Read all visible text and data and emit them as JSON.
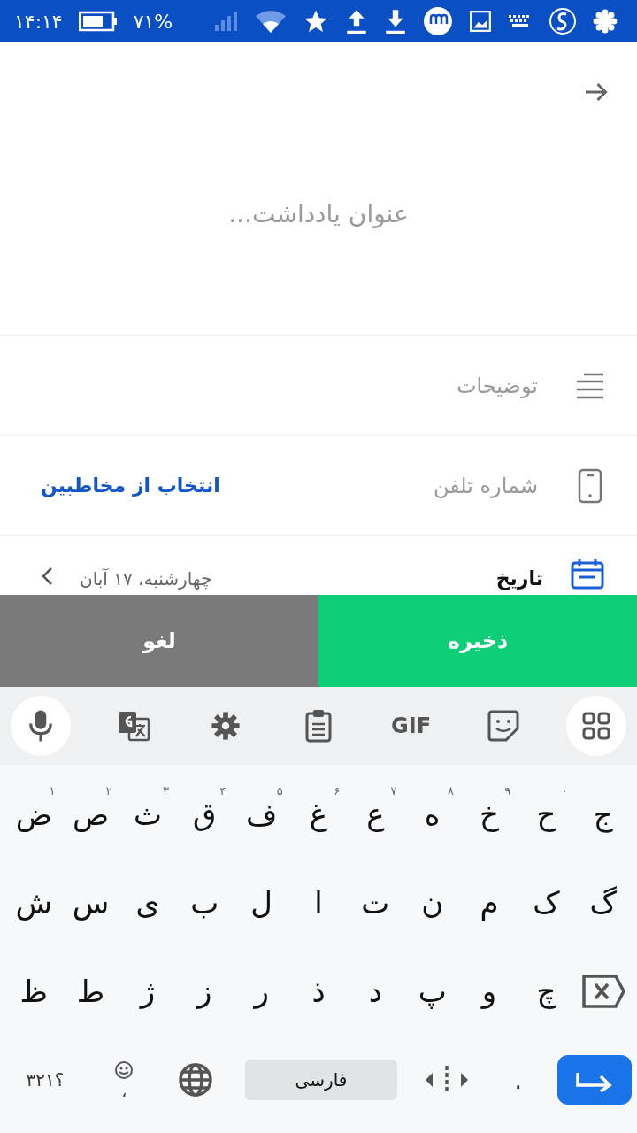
{
  "status_bar": {
    "time": "۱۴:۱۴",
    "battery": "۷۱%"
  },
  "note": {
    "title_placeholder": "عنوان یادداشت...",
    "description_placeholder": "توضیحات",
    "phone_placeholder": "شماره تلفن",
    "contacts_link": "انتخاب از مخاطبین",
    "date_label": "تاریخ",
    "date_value": "چهارشنبه، ۱۷ آبان"
  },
  "actions": {
    "save": "ذخیره",
    "cancel": "لغو"
  },
  "keyboard": {
    "toolbar": {
      "gif": "GIF"
    },
    "rows": [
      [
        {
          "label": "ج"
        },
        {
          "label": "ح",
          "hint": "۰"
        },
        {
          "label": "خ",
          "hint": "۹"
        },
        {
          "label": "ه",
          "hint": "۸"
        },
        {
          "label": "ع",
          "hint": "۷"
        },
        {
          "label": "غ",
          "hint": "۶"
        },
        {
          "label": "ف",
          "hint": "۵"
        },
        {
          "label": "ق",
          "hint": "۴"
        },
        {
          "label": "ث",
          "hint": "۳"
        },
        {
          "label": "ص",
          "hint": "۲"
        },
        {
          "label": "ض",
          "hint": "۱"
        }
      ],
      [
        {
          "label": "گ"
        },
        {
          "label": "ک"
        },
        {
          "label": "م"
        },
        {
          "label": "ن"
        },
        {
          "label": "ت"
        },
        {
          "label": "ا"
        },
        {
          "label": "ل"
        },
        {
          "label": "ب"
        },
        {
          "label": "ی"
        },
        {
          "label": "س"
        },
        {
          "label": "ش"
        }
      ],
      [
        {
          "kind": "backspace"
        },
        {
          "label": "چ"
        },
        {
          "label": "و"
        },
        {
          "label": "پ"
        },
        {
          "label": "د"
        },
        {
          "label": "ذ"
        },
        {
          "label": "ر"
        },
        {
          "label": "ز"
        },
        {
          "label": "ژ"
        },
        {
          "label": "ط"
        },
        {
          "label": "ظ"
        }
      ]
    ],
    "period": ".",
    "space": "فارسی",
    "comma": "،",
    "symbols": "؟۳۲۱"
  }
}
